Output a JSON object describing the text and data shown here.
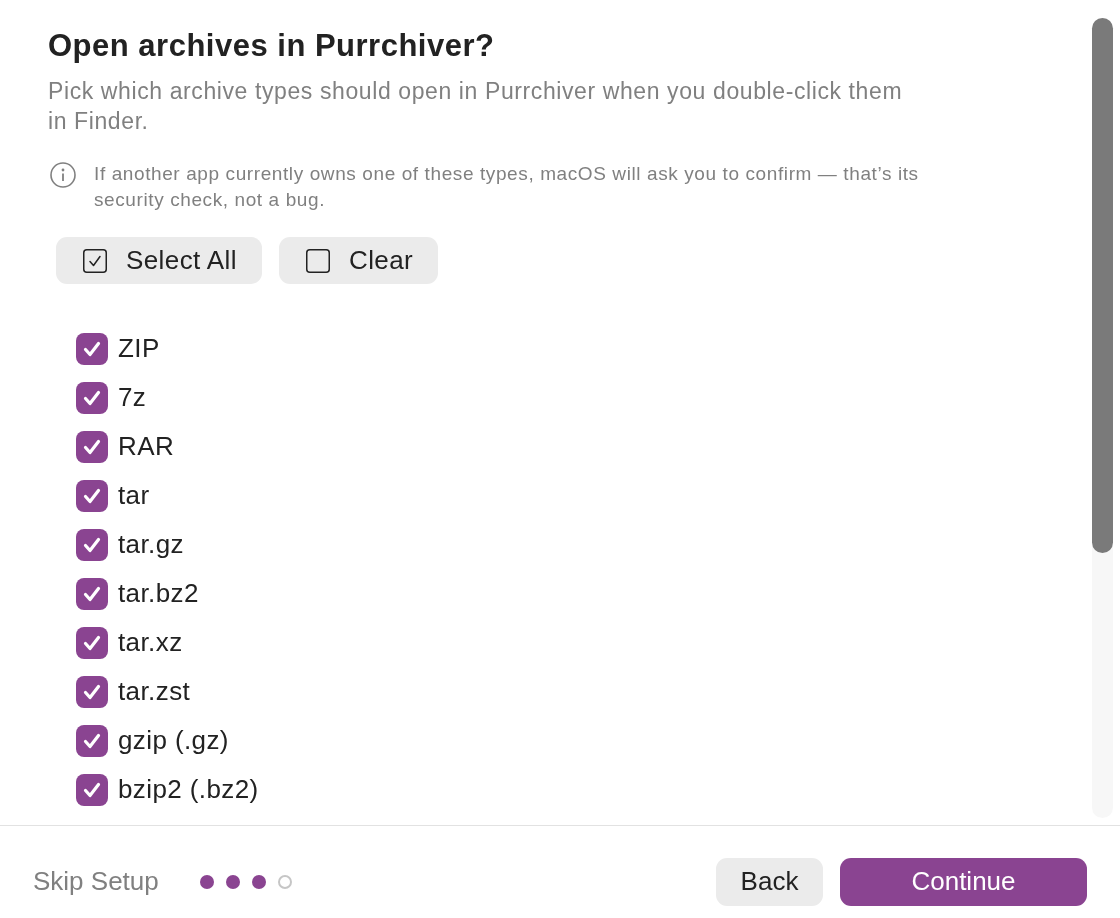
{
  "title": "Open archives in Purrchiver?",
  "subtitle": "Pick which archive types should open in Purrchiver when you double-click them in Finder.",
  "info_note": "If another app currently owns one of these types, macOS will ask you to confirm — that’s its security check, not a bug.",
  "select_all_button": "Select All",
  "clear_button": "Clear",
  "archive_types": [
    {
      "label": "ZIP",
      "checked": true
    },
    {
      "label": "7z",
      "checked": true
    },
    {
      "label": "RAR",
      "checked": true
    },
    {
      "label": "tar",
      "checked": true
    },
    {
      "label": "tar.gz",
      "checked": true
    },
    {
      "label": "tar.bz2",
      "checked": true
    },
    {
      "label": "tar.xz",
      "checked": true
    },
    {
      "label": "tar.zst",
      "checked": true
    },
    {
      "label": "gzip (.gz)",
      "checked": true
    },
    {
      "label": "bzip2 (.bz2)",
      "checked": true
    }
  ],
  "footer": {
    "skip_link": "Skip Setup",
    "steps": [
      {
        "done": true
      },
      {
        "done": true
      },
      {
        "done": true
      },
      {
        "done": false
      }
    ],
    "back_button": "Back",
    "continue_button": "Continue"
  }
}
